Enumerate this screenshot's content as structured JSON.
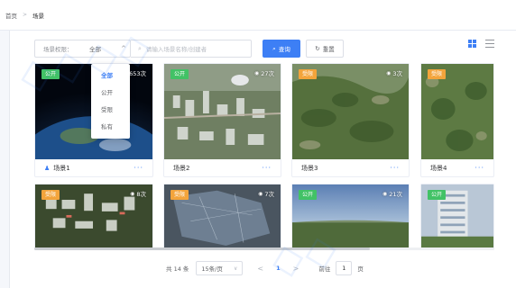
{
  "breadcrumb": {
    "home": "首页",
    "separator": ">",
    "current": "场景"
  },
  "toolbar": {
    "filter_label": "场景权限：",
    "filter_value": "全部",
    "search_placeholder": "请输入场景名称/创建者",
    "search_button": "查询",
    "reset_button": "重置"
  },
  "dropdown": {
    "options": [
      "全部",
      "公开",
      "受限",
      "私有"
    ],
    "selected": "全部"
  },
  "cards": [
    {
      "name": "场景1",
      "tag": "公开",
      "tag_type": "public",
      "views": "653次",
      "scene": "earth",
      "show_user": true
    },
    {
      "name": "场景2",
      "tag": "公开",
      "tag_type": "public",
      "views": "27次",
      "scene": "city"
    },
    {
      "name": "场景3",
      "tag": "受限",
      "tag_type": "review",
      "views": "3次",
      "scene": "forest"
    },
    {
      "name": "场景4",
      "tag": "受限",
      "tag_type": "review",
      "views": "",
      "scene": "forest2"
    },
    {
      "name": "",
      "tag": "受限",
      "tag_type": "review",
      "views": "8次",
      "scene": "buildings"
    },
    {
      "name": "",
      "tag": "受限",
      "tag_type": "review",
      "views": "7次",
      "scene": "map"
    },
    {
      "name": "",
      "tag": "公开",
      "tag_type": "public",
      "views": "21次",
      "scene": "horizon"
    },
    {
      "name": "",
      "tag": "公开",
      "tag_type": "public",
      "views": "",
      "scene": "tower"
    }
  ],
  "pagination": {
    "total_text": "共 14 条",
    "page_size": "15条/页",
    "prev": "<",
    "current_page": "1",
    "next": ">",
    "goto_label": "前往",
    "goto_value": "1",
    "goto_unit": "页"
  },
  "icons": {
    "chevron": "chevron-up-icon",
    "search": "search-icon",
    "refresh": "refresh-icon",
    "eye": "eye-icon",
    "user": "user-icon",
    "more": "more-icon",
    "grid": "grid-view-icon",
    "list": "list-view-icon"
  },
  "colors": {
    "primary": "#3d7ff5",
    "public_tag": "#42c266",
    "review_tag": "#f3a43b"
  }
}
